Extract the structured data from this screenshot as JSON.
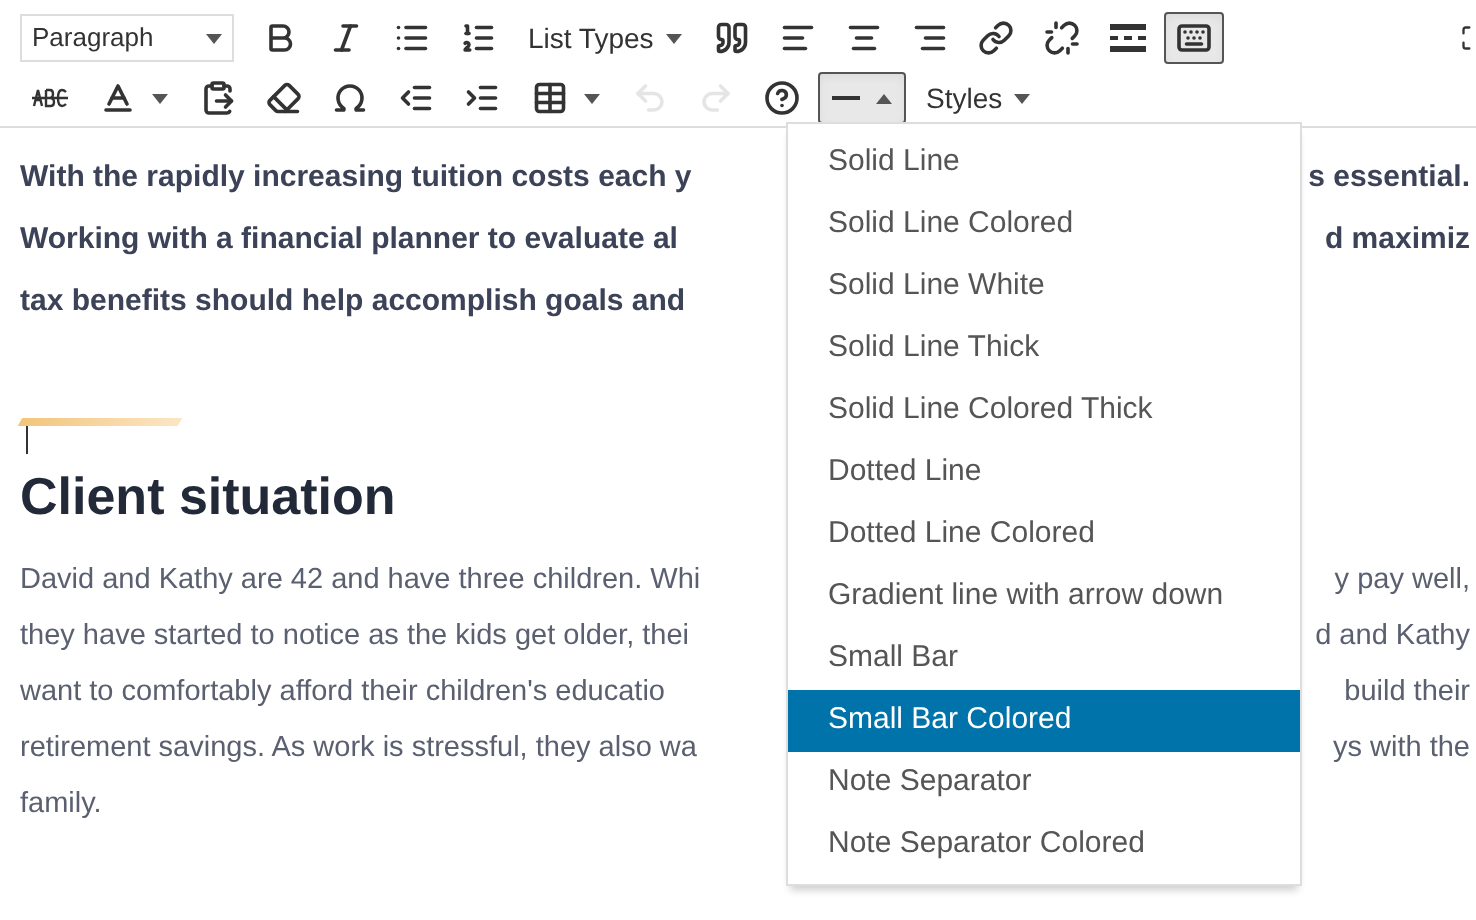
{
  "toolbar": {
    "format_select": {
      "value": "Paragraph"
    },
    "row_1": [
      {
        "kind": "icon",
        "pressed": false
      },
      {
        "kind": "icon",
        "pressed": false
      },
      {
        "kind": "icon",
        "pressed": false
      },
      {
        "kind": "icon",
        "pressed": false
      },
      {
        "kind": "menu",
        "label": "List Types",
        "pressed": false
      },
      {
        "kind": "icon",
        "pressed": false
      },
      {
        "kind": "icon",
        "pressed": false
      },
      {
        "kind": "icon",
        "pressed": false
      },
      {
        "kind": "icon",
        "pressed": false
      },
      {
        "kind": "icon",
        "pressed": false
      },
      {
        "kind": "icon",
        "pressed": false
      },
      {
        "kind": "icon",
        "pressed": false
      },
      {
        "kind": "icon",
        "pressed": true
      }
    ],
    "row_2": [
      {
        "kind": "icon",
        "pressed": false
      },
      {
        "kind": "split",
        "pressed": false
      },
      {
        "kind": "icon",
        "pressed": false
      },
      {
        "kind": "icon",
        "pressed": false
      },
      {
        "kind": "icon",
        "pressed": false
      },
      {
        "kind": "icon",
        "pressed": false
      },
      {
        "kind": "icon",
        "pressed": false
      },
      {
        "kind": "split",
        "pressed": false
      },
      {
        "kind": "icon",
        "pressed": false,
        "disabled": true
      },
      {
        "kind": "icon",
        "pressed": false,
        "disabled": true
      },
      {
        "kind": "icon",
        "pressed": false
      },
      {
        "kind": "split",
        "pressed": true
      },
      {
        "kind": "menu",
        "label": "Styles",
        "pressed": false
      }
    ]
  },
  "intro_lines": [
    {
      "left": "With the rapidly increasing tuition costs each y",
      "right": "s essential."
    },
    {
      "left": "Working with a financial planner to evaluate al",
      "right": "d maximiz"
    },
    {
      "left": "tax benefits should help accomplish goals and"
    }
  ],
  "heading": "Client situation",
  "body_lines": [
    {
      "left": "David and Kathy are 42 and have three children. Whi",
      "right": "y pay well,"
    },
    {
      "left": "they have started to notice as the kids get older, thei",
      "right": "d and Kathy"
    },
    {
      "left": "want to comfortably afford their children's educatio",
      "right": "build their"
    },
    {
      "left": "retirement savings. As work is stressful, they also wa",
      "right": "ys with the"
    },
    {
      "left": "family."
    }
  ],
  "separator_menu": [
    {
      "label": "Solid Line",
      "selected": false
    },
    {
      "label": "Solid Line Colored",
      "selected": false
    },
    {
      "label": "Solid Line White",
      "selected": false
    },
    {
      "label": "Solid Line Thick",
      "selected": false
    },
    {
      "label": "Solid Line Colored Thick",
      "selected": false
    },
    {
      "label": "Dotted Line",
      "selected": false
    },
    {
      "label": "Dotted Line Colored",
      "selected": false
    },
    {
      "label": "Gradient line with arrow down",
      "selected": false
    },
    {
      "label": "Small Bar",
      "selected": false
    },
    {
      "label": "Small Bar Colored",
      "selected": true
    },
    {
      "label": "Note Separator",
      "selected": false
    },
    {
      "label": "Note Separator Colored",
      "selected": false
    }
  ]
}
